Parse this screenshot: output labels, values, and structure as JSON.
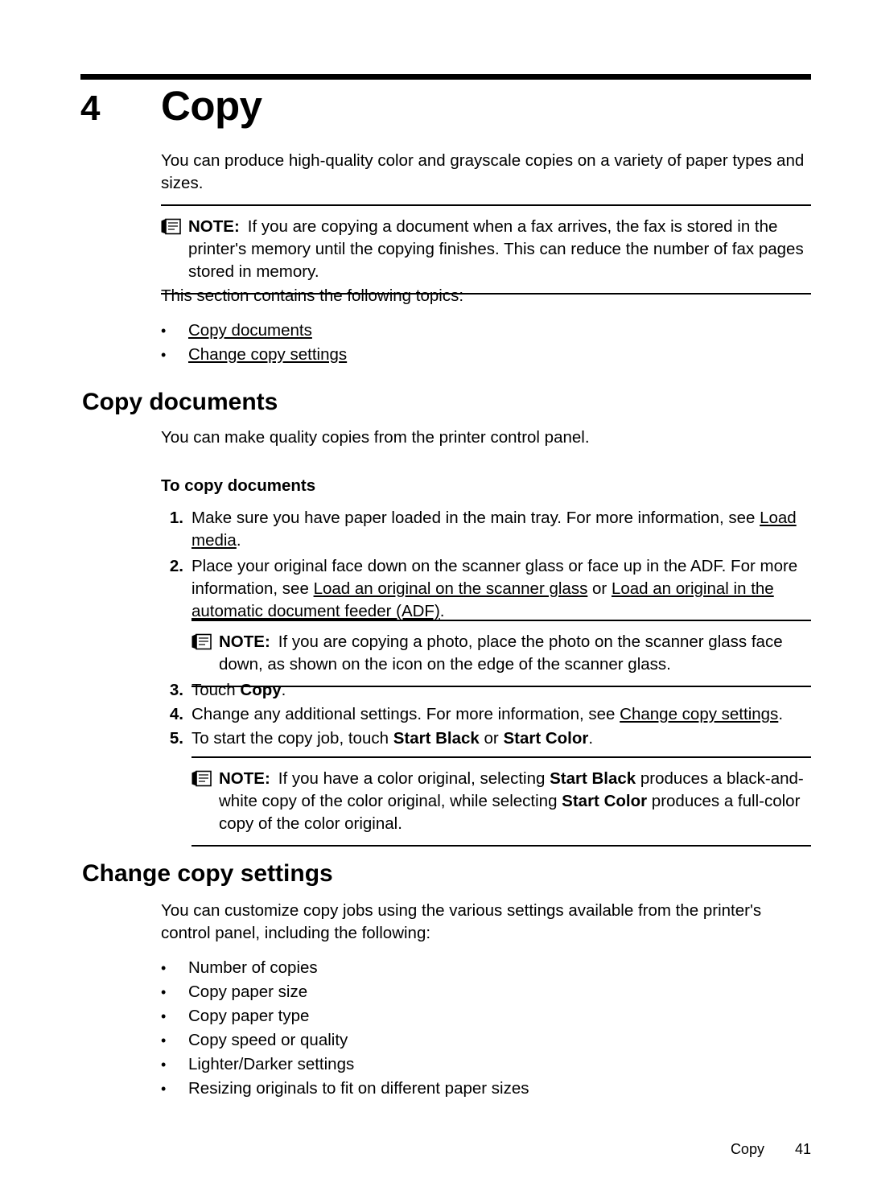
{
  "chapter": {
    "number": "4",
    "title": "Copy"
  },
  "intro": {
    "paragraph": "You can produce high-quality color and grayscale copies on a variety of paper types and sizes.",
    "note_label": "NOTE:",
    "note_icon": "note-pencil-icon",
    "note_text": "If you are copying a document when a fax arrives, the fax is stored in the printer's memory until the copying finishes. This can reduce the number of fax pages stored in memory.",
    "topics_lead": "This section contains the following topics:",
    "topics": [
      "Copy documents",
      "Change copy settings"
    ]
  },
  "copy_documents": {
    "heading": "Copy documents",
    "paragraph": "You can make quality copies from the printer control panel.",
    "subhead": "To copy documents",
    "steps": [
      {
        "num": "1.",
        "parts": [
          {
            "t": "Make sure you have paper loaded in the main tray. For more information, see ",
            "style": "plain"
          },
          {
            "t": "Load media",
            "style": "link"
          },
          {
            "t": ".",
            "style": "plain"
          }
        ]
      },
      {
        "num": "2.",
        "parts": [
          {
            "t": "Place your original face down on the scanner glass or face up in the ADF. For more information, see ",
            "style": "plain"
          },
          {
            "t": "Load an original on the scanner glass",
            "style": "link"
          },
          {
            "t": " or ",
            "style": "plain"
          },
          {
            "t": "Load an original in the automatic document feeder (ADF)",
            "style": "link"
          },
          {
            "t": ".",
            "style": "plain"
          }
        ]
      },
      {
        "num": "3.",
        "parts": [
          {
            "t": "Touch ",
            "style": "plain"
          },
          {
            "t": "Copy",
            "style": "bold"
          },
          {
            "t": ".",
            "style": "plain"
          }
        ]
      },
      {
        "num": "4.",
        "parts": [
          {
            "t": "Change any additional settings. For more information, see ",
            "style": "plain"
          },
          {
            "t": "Change copy settings",
            "style": "link"
          },
          {
            "t": ".",
            "style": "plain"
          }
        ]
      },
      {
        "num": "5.",
        "parts": [
          {
            "t": "To start the copy job, touch ",
            "style": "plain"
          },
          {
            "t": "Start Black",
            "style": "bold"
          },
          {
            "t": " or ",
            "style": "plain"
          },
          {
            "t": "Start Color",
            "style": "bold"
          },
          {
            "t": ".",
            "style": "plain"
          }
        ]
      }
    ],
    "note_photo": {
      "label": "NOTE:",
      "icon": "note-pencil-icon",
      "text": "If you are copying a photo, place the photo on the scanner glass face down, as shown on the icon on the edge of the scanner glass."
    },
    "note_color": {
      "label": "NOTE:",
      "icon": "note-pencil-icon",
      "parts": [
        {
          "t": "If you have a color original, selecting ",
          "style": "plain"
        },
        {
          "t": "Start Black",
          "style": "bold"
        },
        {
          "t": " produces a black-and-white copy of the color original, while selecting ",
          "style": "plain"
        },
        {
          "t": "Start Color",
          "style": "bold"
        },
        {
          "t": " produces a full-color copy of the color original.",
          "style": "plain"
        }
      ]
    }
  },
  "change_copy_settings": {
    "heading": "Change copy settings",
    "paragraph": "You can customize copy jobs using the various settings available from the printer's control panel, including the following:",
    "items": [
      "Number of copies",
      "Copy paper size",
      "Copy paper type",
      "Copy speed or quality",
      "Lighter/Darker settings",
      "Resizing originals to fit on different paper sizes"
    ]
  },
  "footer": {
    "label": "Copy",
    "page_number": "41"
  }
}
